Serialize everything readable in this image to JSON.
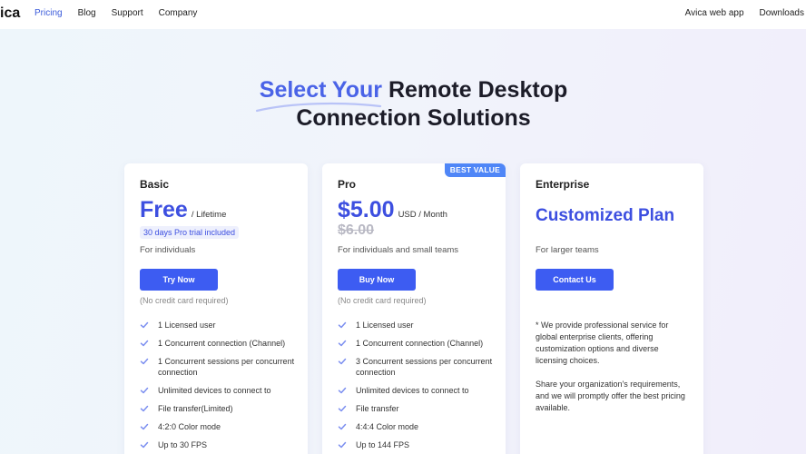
{
  "nav": {
    "logo": "ica",
    "links": [
      "Pricing",
      "Blog",
      "Support",
      "Company"
    ],
    "right_links": [
      "Avica web app",
      "Downloads"
    ]
  },
  "hero": {
    "highlight": "Select Your",
    "line1_rest": " Remote Desktop",
    "line2": "Connection Solutions"
  },
  "plans": {
    "basic": {
      "name": "Basic",
      "price": "Free",
      "unit": "/ Lifetime",
      "trial": "30 days Pro trial included",
      "tagline": "For individuals",
      "button": "Try Now",
      "note": "(No credit card required)",
      "features": [
        "1 Licensed user",
        "1 Concurrent connection (Channel)",
        "1 Concurrent sessions per concurrent connection",
        "Unlimited devices to connect to",
        "File transfer(Limited)",
        "4:2:0 Color mode",
        "Up to 30 FPS"
      ]
    },
    "pro": {
      "name": "Pro",
      "ribbon": "BEST VALUE",
      "price": "$5.00",
      "unit": "USD / Month",
      "old_price": "$6.00",
      "tagline": "For individuals and small teams",
      "button": "Buy Now",
      "note": "(No credit card required)",
      "features": [
        "1 Licensed user",
        "1 Concurrent connection (Channel)",
        "3 Concurrent sessions per concurrent connection",
        "Unlimited devices to connect to",
        "File transfer",
        "4:4:4 Color mode",
        "Up to 144 FPS"
      ]
    },
    "enterprise": {
      "name": "Enterprise",
      "price": "Customized Plan",
      "tagline": "For larger teams",
      "button": "Contact Us",
      "paragraph1": "* We provide professional service for global enterprise clients, offering customization options and diverse licensing choices.",
      "paragraph2": "Share your organization's requirements, and we will promptly offer the best pricing available."
    }
  },
  "colors": {
    "accent": "#3d4fe0",
    "button": "#3d5cf2",
    "ribbon": "#4f86f7",
    "check": "#7b8ef0"
  }
}
